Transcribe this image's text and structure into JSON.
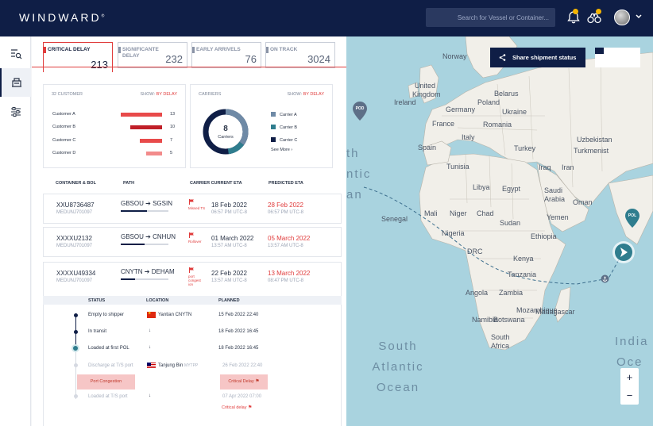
{
  "app": {
    "brand": "WINDWARD",
    "brand_mark": "®"
  },
  "search": {
    "placeholder": "Search for Vessel or Container..."
  },
  "tabs": [
    {
      "label": "CRITICAL DELAY",
      "count": "213",
      "active": true
    },
    {
      "label": "SIGNIFICANTE DELAY",
      "count": "232"
    },
    {
      "label": "EARLY ARRIVELS",
      "count": "76"
    },
    {
      "label": "ON TRACK",
      "count": "3024"
    }
  ],
  "customers_card": {
    "title": "32 CUSTOMER",
    "show_label": "SHOW:",
    "show_value": "BY DELAY",
    "rows": [
      {
        "name": "Customer A",
        "value": 13,
        "color": "#e84a4a"
      },
      {
        "name": "Customer B",
        "value": 10,
        "color": "#c01f28"
      },
      {
        "name": "Customer C",
        "value": 7,
        "color": "#e84a4a"
      },
      {
        "name": "Customer D",
        "value": 5,
        "color": "#f28b8b"
      }
    ]
  },
  "carriers_card": {
    "title": "CARRIERS",
    "show_label": "SHOW:",
    "show_value": "BY DELAY",
    "center_value": "8",
    "center_label": "Carriers",
    "legend": [
      {
        "name": "Carrier A",
        "color": "#6f8aa6"
      },
      {
        "name": "Carrier B",
        "color": "#2f7d8e"
      },
      {
        "name": "Carrier C",
        "color": "#0f1e46"
      }
    ],
    "see_more": "See More ›"
  },
  "table": {
    "headers": {
      "container": "CONTAINER & BOL",
      "path": "PATH",
      "eta": "CARRIER CURRENT ETA",
      "peta": "PREDICTED ETA"
    },
    "rows": [
      {
        "container": "XXU8736487",
        "bol": "MEDUNJ701097",
        "from": "GBSOU",
        "to": "SGSIN",
        "arrow": "➔",
        "progress": 0.55,
        "flag_text": "Missed TS",
        "eta_date": "18 Feb 2022",
        "eta_time": "06:57 PM UTC-8",
        "peta_date": "28 Feb 2022",
        "peta_time": "06:57 PM UTC-8"
      },
      {
        "container": "XXXXU2132",
        "bol": "MEDUNJ701097",
        "from": "GBSOU",
        "to": "CNHUN",
        "arrow": "➔",
        "progress": 0.5,
        "flag_text": "Rollover",
        "eta_date": "01 March 2022",
        "eta_time": "13:57 AM UTC-8",
        "peta_date": "05 March 2022",
        "peta_time": "13:57 AM UTC-8"
      },
      {
        "container": "XXXXU49334",
        "bol": "MEDUNJ701097",
        "from": "CNYTN",
        "to": "DEHAM",
        "arrow": "➔",
        "progress": 0.3,
        "flag_text": "port congest ion",
        "eta_date": "22 Feb 2022",
        "eta_time": "13:57 AM UTC-8",
        "peta_date": "13 March 2022",
        "peta_time": "08:47 PM UTC-8"
      }
    ]
  },
  "status": {
    "headers": {
      "status": "STATUS",
      "location": "LOCATION",
      "planned": "PLANNED"
    },
    "steps": [
      {
        "status": "Empty to shipper",
        "location": "Yantian CNYTN",
        "planned": "15 Feb 2022 22:40"
      },
      {
        "status": "In transit",
        "location": "↓",
        "planned": "18 Feb 2022 16:45"
      },
      {
        "status": "Loaded at first POL",
        "location": "↓",
        "planned": "18 Feb 2022 16:45"
      },
      {
        "status": "Discharge at T/S port",
        "location": "Tanjung Bin",
        "location_code": "MYTPP",
        "planned": "26 Feb 2022 22:40"
      },
      {
        "status": "Loaded at T/S port",
        "location": "↓",
        "planned": "07 Apr 2022 07:00"
      }
    ],
    "badge_port": "Port Congestion",
    "badge_critical": "Critical Delay",
    "critical_delay_text": "Critical delay"
  },
  "map": {
    "share_label": "Share shipment status",
    "labels": {
      "norway": "Norway",
      "united_kingdom_1": "United",
      "united_kingdom_2": "Kingdom",
      "ireland": "Ireland",
      "poland": "Poland",
      "belarus": "Belarus",
      "germany": "Germany",
      "ukraine": "Ukraine",
      "france": "France",
      "romania": "Romania",
      "italy": "Italy",
      "spain": "Spain",
      "turkey": "Turkey",
      "uzbekistan": "Uzbekistan",
      "turkmenistan": "Turkmenist",
      "tunisia": "Tunisia",
      "iraq": "Iraq",
      "iran": "Iran",
      "libya": "Libya",
      "egypt": "Egypt",
      "saudi": "Saudi",
      "arabia": "Arabia",
      "oman": "Oman",
      "mali": "Mali",
      "niger": "Niger",
      "chad": "Chad",
      "sudan": "Sudan",
      "yemen": "Yemen",
      "senegal": "Senegal",
      "nigeria": "Nigeria",
      "ethiopia": "Ethiopia",
      "kenya": "Kenya",
      "tanzania": "Tanzania",
      "angola": "Angola",
      "namibia": "Namibia",
      "botswana": "Botswana",
      "south_africa_1": "South",
      "south_africa_2": "Africa",
      "madagascar": "Madagascar",
      "zambia": "Zambia",
      "mozambique": "Mozambique",
      "drc": "DRC"
    },
    "oceans": {
      "north_atlantic_1": "th",
      "north_atlantic_2": "ntic",
      "north_atlantic_3": "an",
      "south_atlantic_1": "South",
      "south_atlantic_2": "Atlantic",
      "south_atlantic_3": "Ocean",
      "indian_1": "India",
      "indian_2": "Oce"
    },
    "pod_label": "POD",
    "pol_label": "POL",
    "zoom_in": "+",
    "zoom_out": "−"
  },
  "colors": {
    "nav": "#0f1e46",
    "accent_red": "#e03c3c",
    "notif_dot": "#f4b400",
    "map_sea": "#a9d3df",
    "map_land": "#f1efe9"
  }
}
